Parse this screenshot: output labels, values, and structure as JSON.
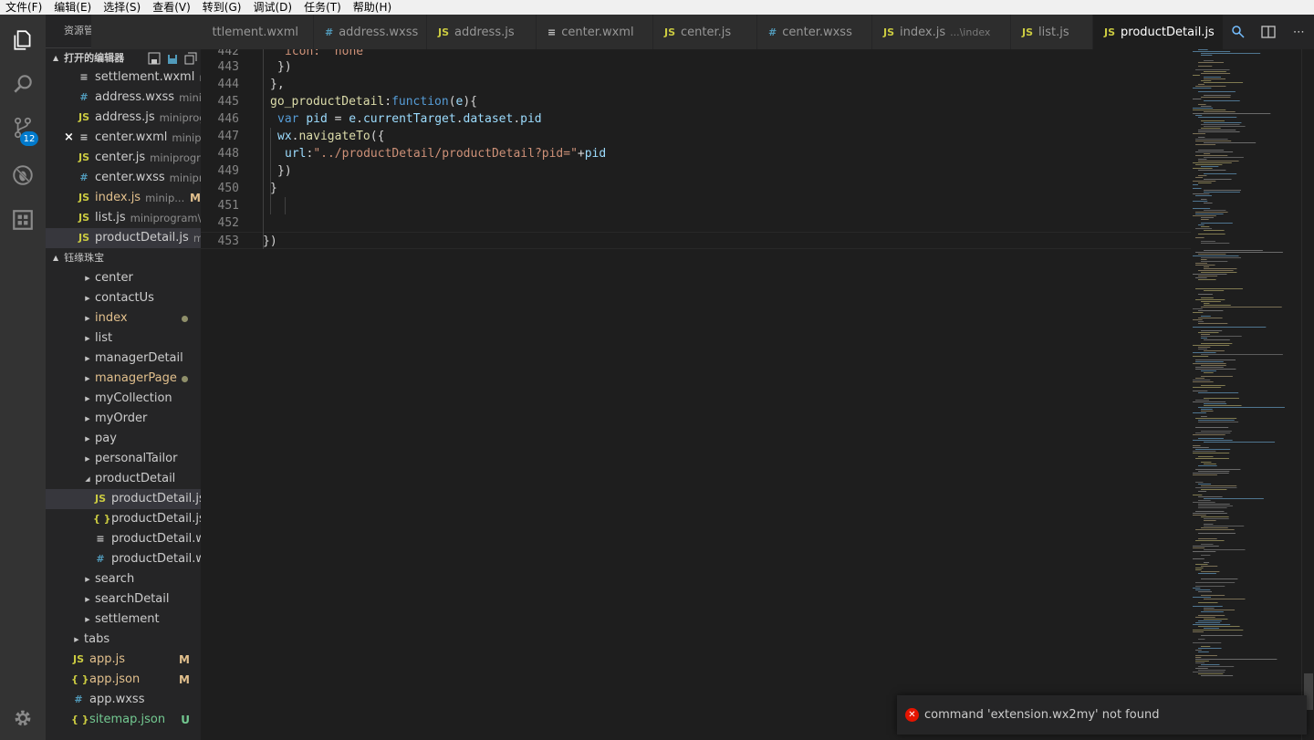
{
  "menu": [
    "文件(F)",
    "编辑(E)",
    "选择(S)",
    "查看(V)",
    "转到(G)",
    "调试(D)",
    "任务(T)",
    "帮助(H)"
  ],
  "activity": {
    "scm_badge": "12",
    "icons": [
      "files-icon",
      "search-icon",
      "source-control-icon",
      "debug-icon",
      "extensions-icon",
      "settings-gear-icon"
    ]
  },
  "sidebar": {
    "title": "资源管理器",
    "open_editors_label": "打开的编辑器",
    "open_editors": [
      {
        "icon": "xml",
        "name": "settlement.wxml",
        "desc": "m..."
      },
      {
        "icon": "css",
        "name": "address.wxss",
        "desc": "mini..."
      },
      {
        "icon": "js",
        "name": "address.js",
        "desc": "miniprog..."
      },
      {
        "icon": "xml",
        "name": "center.wxml",
        "desc": "minip...",
        "close": "×"
      },
      {
        "icon": "js",
        "name": "center.js",
        "desc": "miniprogr..."
      },
      {
        "icon": "css",
        "name": "center.wxss",
        "desc": "minipr..."
      },
      {
        "icon": "js",
        "name": "index.js",
        "desc": "minip...",
        "mark": "M"
      },
      {
        "icon": "js",
        "name": "list.js",
        "desc": "miniprogram\\..."
      },
      {
        "icon": "js",
        "name": "productDetail.js",
        "desc": "m..."
      }
    ],
    "project_label": "钰缘珠宝",
    "tree": [
      {
        "name": "center",
        "type": "folder",
        "depth": 1
      },
      {
        "name": "contactUs",
        "type": "folder",
        "depth": 1
      },
      {
        "name": "index",
        "type": "folder",
        "depth": 1,
        "dot": true
      },
      {
        "name": "list",
        "type": "folder",
        "depth": 1
      },
      {
        "name": "managerDetail",
        "type": "folder",
        "depth": 1
      },
      {
        "name": "managerPage",
        "type": "folder",
        "depth": 1,
        "dot": true
      },
      {
        "name": "myCollection",
        "type": "folder",
        "depth": 1
      },
      {
        "name": "myOrder",
        "type": "folder",
        "depth": 1
      },
      {
        "name": "pay",
        "type": "folder",
        "depth": 1
      },
      {
        "name": "personalTailor",
        "type": "folder",
        "depth": 1
      },
      {
        "name": "productDetail",
        "type": "folder-open",
        "depth": 1
      },
      {
        "name": "productDetail.js",
        "type": "js",
        "depth": 2,
        "selected": true
      },
      {
        "name": "productDetail.js...",
        "type": "json",
        "depth": 2
      },
      {
        "name": "productDetail.w...",
        "type": "xml",
        "depth": 2
      },
      {
        "name": "productDetail.w...",
        "type": "css",
        "depth": 2
      },
      {
        "name": "search",
        "type": "folder",
        "depth": 1
      },
      {
        "name": "searchDetail",
        "type": "folder",
        "depth": 1
      },
      {
        "name": "settlement",
        "type": "folder",
        "depth": 1
      },
      {
        "name": "tabs",
        "type": "folder",
        "depth": 0
      },
      {
        "name": "app.js",
        "type": "js",
        "depth": 0,
        "mark": "M"
      },
      {
        "name": "app.json",
        "type": "json",
        "depth": 0,
        "mark": "M"
      },
      {
        "name": "app.wxss",
        "type": "css",
        "depth": 0
      },
      {
        "name": "sitemap.json",
        "type": "json",
        "depth": 0,
        "mark": "U"
      }
    ]
  },
  "tabs": [
    {
      "icon": "xml",
      "name": "ttlement.wxml"
    },
    {
      "icon": "css",
      "name": "address.wxss"
    },
    {
      "icon": "js",
      "name": "address.js"
    },
    {
      "icon": "xml",
      "name": "center.wxml"
    },
    {
      "icon": "js",
      "name": "center.js"
    },
    {
      "icon": "css",
      "name": "center.wxss"
    },
    {
      "icon": "js",
      "name": "index.js",
      "desc": "...\\index"
    },
    {
      "icon": "js",
      "name": "list.js"
    },
    {
      "icon": "js",
      "name": "productDetail.js",
      "active": true,
      "close": "×"
    }
  ],
  "icon_glyphs": {
    "js": "JS",
    "css": "#",
    "xml": "≡",
    "json": "{ }"
  },
  "editor": {
    "lines": [
      {
        "num": "442",
        "indent": 3,
        "tokens": [
          [
            "str",
            "icon: \"none\""
          ]
        ]
      },
      {
        "num": "443",
        "indent": 2,
        "tokens": [
          [
            "br",
            "})"
          ]
        ]
      },
      {
        "num": "444",
        "indent": 1,
        "tokens": [
          [
            "br",
            "},"
          ]
        ]
      },
      {
        "num": "445",
        "indent": 1,
        "tokens": [
          [
            "fn",
            "go_productDetail"
          ],
          [
            "br",
            ":"
          ],
          [
            "kw",
            "function"
          ],
          [
            "br",
            "("
          ],
          [
            "var",
            "e"
          ],
          [
            "br",
            "){"
          ]
        ]
      },
      {
        "num": "446",
        "indent": 2,
        "tokens": [
          [
            "kw",
            "var "
          ],
          [
            "var",
            "pid"
          ],
          [
            "br",
            " = "
          ],
          [
            "var",
            "e"
          ],
          [
            "br",
            "."
          ],
          [
            "var",
            "currentTarget"
          ],
          [
            "br",
            "."
          ],
          [
            "var",
            "dataset"
          ],
          [
            "br",
            "."
          ],
          [
            "var",
            "pid"
          ]
        ]
      },
      {
        "num": "447",
        "indent": 2,
        "tokens": [
          [
            "var",
            "wx"
          ],
          [
            "br",
            "."
          ],
          [
            "fn",
            "navigateTo"
          ],
          [
            "br",
            "({"
          ]
        ]
      },
      {
        "num": "448",
        "indent": 3,
        "tokens": [
          [
            "var",
            "url"
          ],
          [
            "br",
            ":"
          ],
          [
            "str",
            "\"../productDetail/productDetail?pid=\""
          ],
          [
            "br",
            "+"
          ],
          [
            "var",
            "pid"
          ]
        ]
      },
      {
        "num": "449",
        "indent": 2,
        "tokens": [
          [
            "br",
            "})"
          ]
        ]
      },
      {
        "num": "450",
        "indent": 1,
        "tokens": [
          [
            "br",
            "}"
          ]
        ]
      },
      {
        "num": "451",
        "indent": 0,
        "tokens": []
      },
      {
        "num": "452",
        "indent": 0,
        "tokens": []
      },
      {
        "num": "453",
        "indent": 0,
        "tokens": [
          [
            "br",
            "})"
          ]
        ],
        "current": true
      }
    ]
  },
  "notification": {
    "message": "command 'extension.wx2my' not found",
    "level_glyph": "✕"
  }
}
